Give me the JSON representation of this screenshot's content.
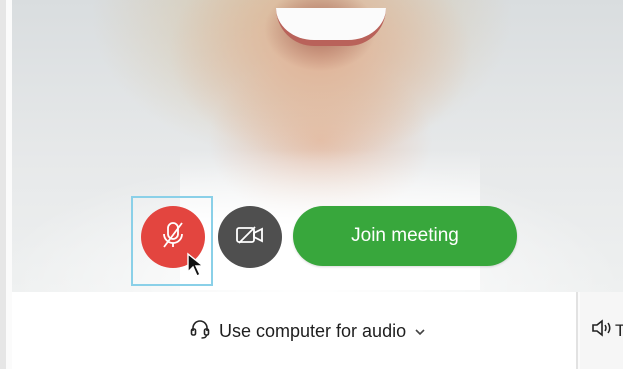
{
  "preview": {
    "mic_button_label": "Mute",
    "video_button_label": "Start video"
  },
  "actions": {
    "join_label": "Join meeting"
  },
  "audio": {
    "option_label": "Use computer for audio",
    "speaker_label": "T"
  },
  "icons": {
    "mic": "mic-muted-icon",
    "camera": "video-off-icon",
    "headset": "headset-icon",
    "chevron": "chevron-down-icon",
    "speaker": "speaker-icon",
    "cursor": "mouse-pointer-icon"
  },
  "colors": {
    "mic_muted": "#e3453f",
    "camera_button": "#4f4f4f",
    "join_button": "#38a73c",
    "focus_outline": "#8ad0e8"
  }
}
